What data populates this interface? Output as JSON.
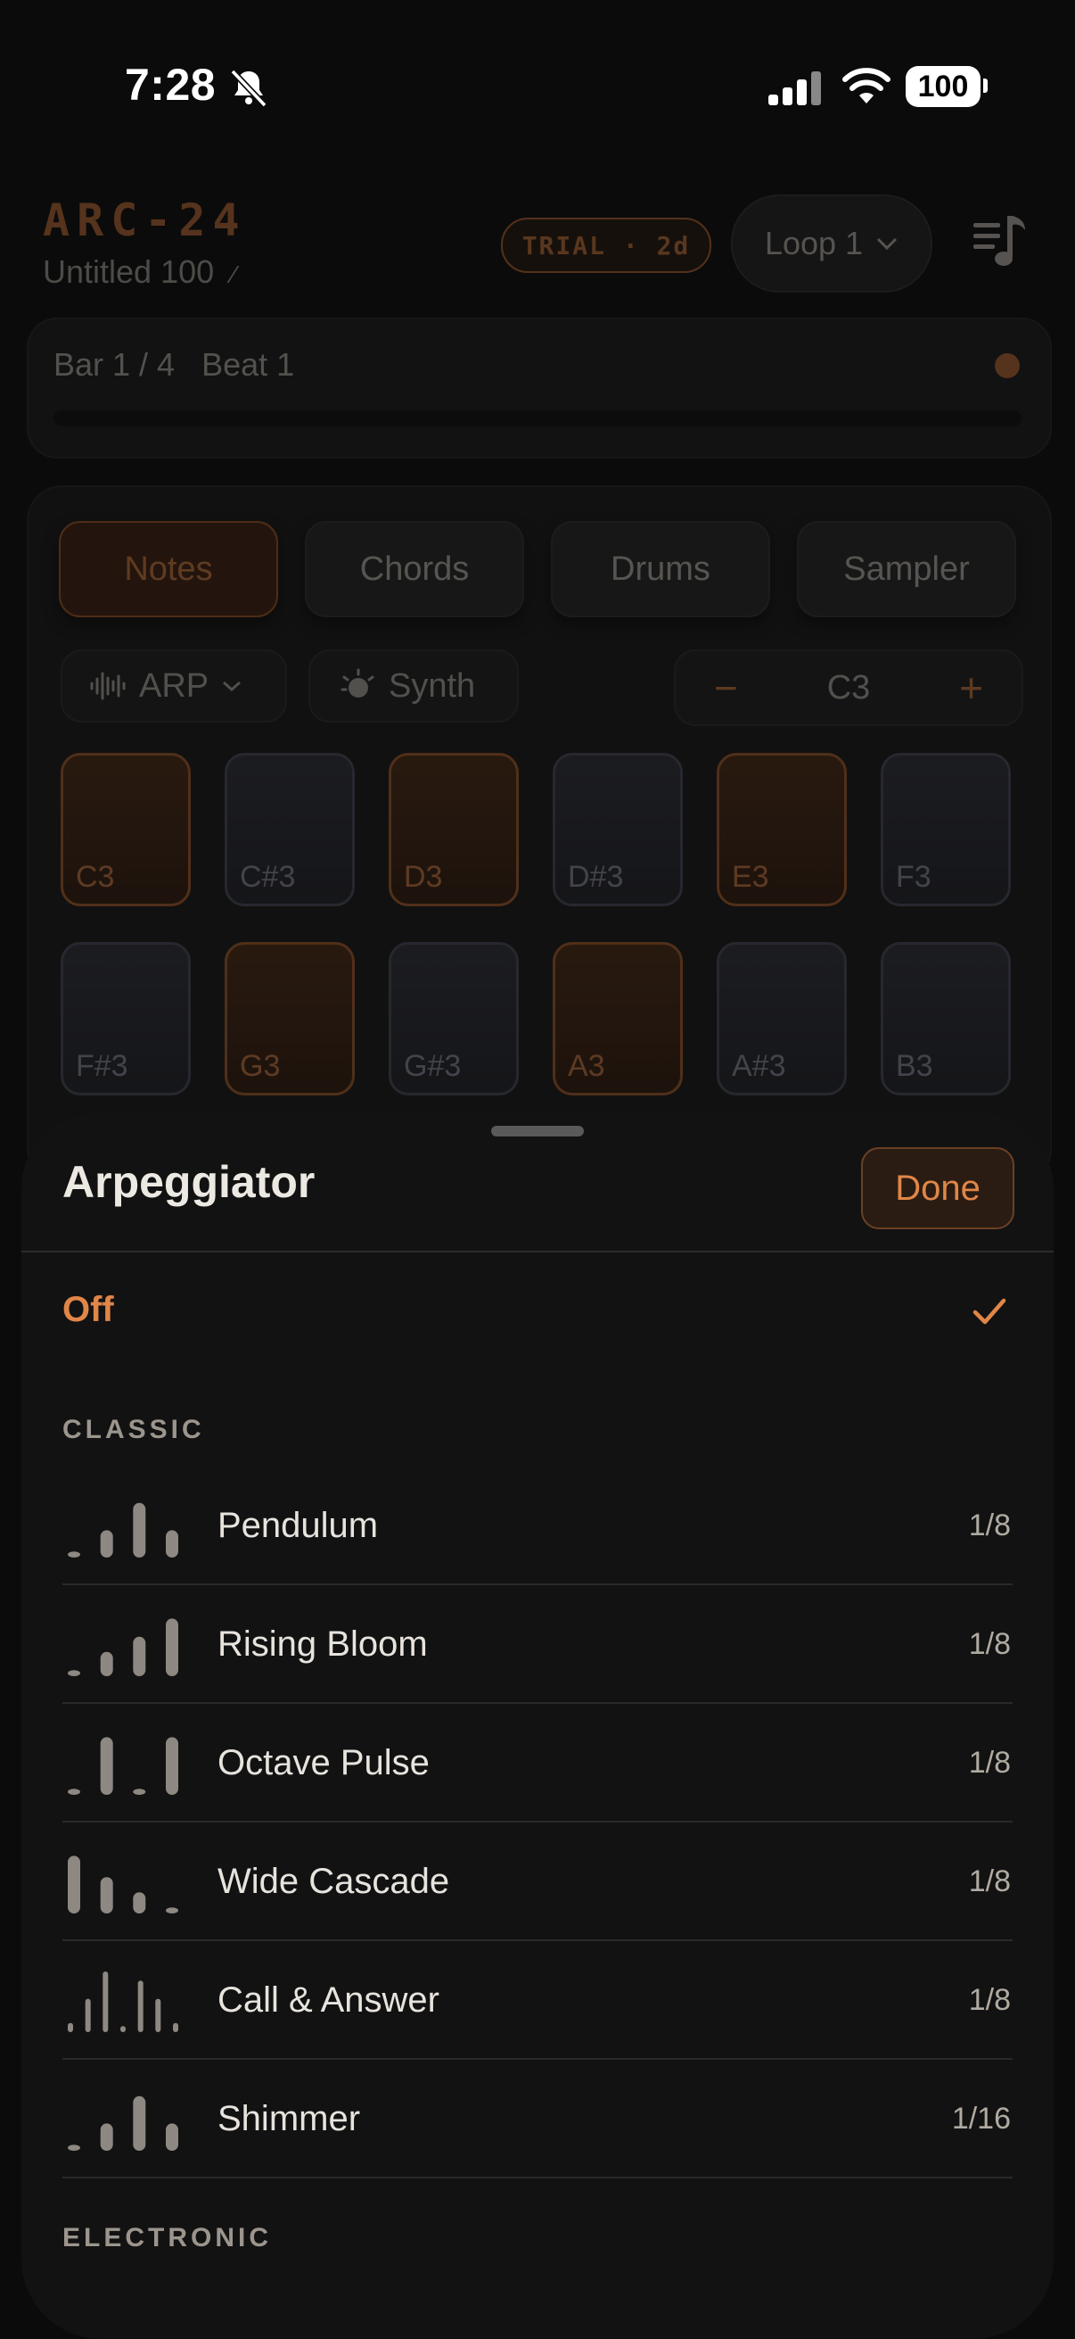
{
  "status": {
    "time": "7:28",
    "battery": "100"
  },
  "header": {
    "brand": "ARC-24",
    "project": "Untitled 100",
    "trial_badge": "TRIAL · 2d",
    "loop_select": "Loop 1"
  },
  "transport": {
    "position": "Bar 1 / 4   Beat 1"
  },
  "tabs": [
    {
      "label": "Notes",
      "active": true
    },
    {
      "label": "Chords",
      "active": false
    },
    {
      "label": "Drums",
      "active": false
    },
    {
      "label": "Sampler",
      "active": false
    }
  ],
  "controls": {
    "arp_label": "ARP",
    "synth_label": "Synth",
    "octave_minus": "−",
    "octave_value": "C3",
    "octave_plus": "+"
  },
  "pads": [
    {
      "note": "C3",
      "type": "natural"
    },
    {
      "note": "C#3",
      "type": "sharp"
    },
    {
      "note": "D3",
      "type": "natural"
    },
    {
      "note": "D#3",
      "type": "sharp"
    },
    {
      "note": "E3",
      "type": "natural"
    },
    {
      "note": "F3",
      "type": "sharp"
    },
    {
      "note": "F#3",
      "type": "sharp"
    },
    {
      "note": "G3",
      "type": "natural"
    },
    {
      "note": "G#3",
      "type": "sharp"
    },
    {
      "note": "A3",
      "type": "natural"
    },
    {
      "note": "A#3",
      "type": "sharp"
    },
    {
      "note": "B3",
      "type": "sharp"
    }
  ],
  "sheet": {
    "title": "Arpeggiator",
    "done_label": "Done",
    "off_label": "Off",
    "sections": [
      {
        "label": "CLASSIC",
        "items": [
          {
            "name": "Pendulum",
            "rate": "1/8",
            "pattern": [
              0.1,
              0.45,
              0.9,
              0.45
            ]
          },
          {
            "name": "Rising Bloom",
            "rate": "1/8",
            "pattern": [
              0.1,
              0.4,
              0.65,
              0.95
            ]
          },
          {
            "name": "Octave Pulse",
            "rate": "1/8",
            "pattern": [
              0.1,
              0.95,
              0.1,
              0.95
            ]
          },
          {
            "name": "Wide Cascade",
            "rate": "1/8",
            "pattern": [
              0.95,
              0.6,
              0.35,
              0.1
            ]
          },
          {
            "name": "Call & Answer",
            "rate": "1/8",
            "pattern": [
              0.15,
              0.55,
              1.0,
              0.1,
              0.85,
              0.55,
              0.15
            ]
          },
          {
            "name": "Shimmer",
            "rate": "1/16",
            "pattern": [
              0.1,
              0.45,
              0.9,
              0.45
            ]
          }
        ]
      },
      {
        "label": "ELECTRONIC",
        "items": []
      }
    ]
  }
}
